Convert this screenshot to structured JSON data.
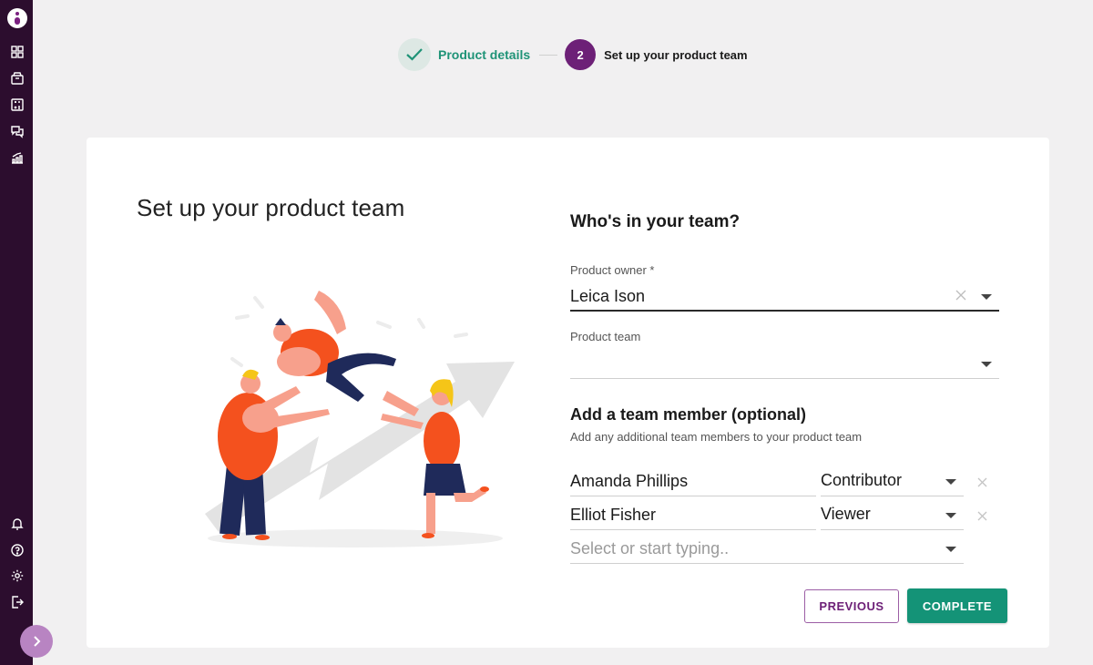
{
  "stepper": {
    "step1_label": "Product details",
    "step2_number": "2",
    "step2_label": "Set up your product team"
  },
  "card": {
    "title": "Set up your product team"
  },
  "form": {
    "team_heading": "Who's in your team?",
    "owner_label": "Product owner *",
    "owner_value": "Leica Ison",
    "team_label": "Product team",
    "team_value": "",
    "member_heading": "Add a team member (optional)",
    "member_helper": "Add any additional team members to your product team",
    "members": [
      {
        "name": "Amanda Phillips",
        "role": "Contributor"
      },
      {
        "name": "Elliot Fisher",
        "role": "Viewer"
      }
    ],
    "new_member_placeholder": "Select or start typing.."
  },
  "buttons": {
    "previous": "PREVIOUS",
    "complete": "COMPLETE"
  },
  "sidebar": {
    "icons": [
      "dashboard-icon",
      "box-icon",
      "calculator-icon",
      "chat-icon",
      "chart-icon",
      "bell-icon",
      "help-icon",
      "settings-icon",
      "logout-icon"
    ]
  },
  "colors": {
    "sidebar_bg": "#2c0d2e",
    "brand_purple": "#6d2077",
    "accent_green": "#149377",
    "illustration_orange": "#f4511e"
  }
}
